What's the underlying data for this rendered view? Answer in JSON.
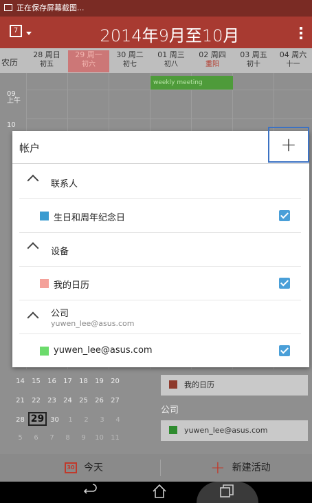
{
  "status_bar": {
    "text": "正在保存屏幕截图..."
  },
  "header": {
    "title": "2014年9月至10月",
    "calendar_icon_text": "7"
  },
  "day_header": {
    "lunar_label": "农历",
    "days": [
      {
        "date": "28",
        "weekday": "周日",
        "lunar": "初五"
      },
      {
        "date": "29",
        "weekday": "周一",
        "lunar": "初六"
      },
      {
        "date": "30",
        "weekday": "周二",
        "lunar": "初七"
      },
      {
        "date": "01",
        "weekday": "周三",
        "lunar": "初八"
      },
      {
        "date": "02",
        "weekday": "周四",
        "lunar": "重阳"
      },
      {
        "date": "03",
        "weekday": "周五",
        "lunar": "初十"
      },
      {
        "date": "04",
        "weekday": "周六",
        "lunar": "十一"
      }
    ]
  },
  "grid": {
    "time_labels": [
      "09\n上午",
      "10"
    ],
    "event": "weekly meeting"
  },
  "mini_calendar": {
    "rows": [
      [
        "14",
        "15",
        "16",
        "17",
        "18",
        "19",
        "20"
      ],
      [
        "21",
        "22",
        "23",
        "24",
        "25",
        "26",
        "27"
      ],
      [
        "28",
        "29",
        "30",
        "1",
        "2",
        "3",
        "4"
      ],
      [
        "5",
        "6",
        "7",
        "8",
        "9",
        "10",
        "11"
      ]
    ]
  },
  "side_panel": {
    "my_calendar": "我的日历",
    "company_label": "公司",
    "company_account": "yuwen_lee@asus.com"
  },
  "action_bar": {
    "today_label": "今天",
    "today_icon_text": "30",
    "new_event_label": "新建活动"
  },
  "dialog": {
    "title": "帐户",
    "add_button": "+",
    "groups": [
      {
        "label": "联系人"
      },
      {
        "label": "设备"
      },
      {
        "label": "公司",
        "sublabel": "yuwen_lee@asus.com"
      }
    ],
    "calendars": [
      {
        "label": "生日和周年纪念日",
        "color": "#3a9bd0",
        "checked": true
      },
      {
        "label": "我的日历",
        "color": "#f4a19a",
        "checked": true
      },
      {
        "label": "yuwen_lee@asus.com",
        "color": "#6cdb6c",
        "checked": true
      }
    ]
  },
  "colors": {
    "header": "#a83a31",
    "status_bar": "#7a2b24",
    "accent": "#c0392b",
    "checkbox": "#4a9fd8",
    "dialog_add_outline": "#3c72c3"
  }
}
